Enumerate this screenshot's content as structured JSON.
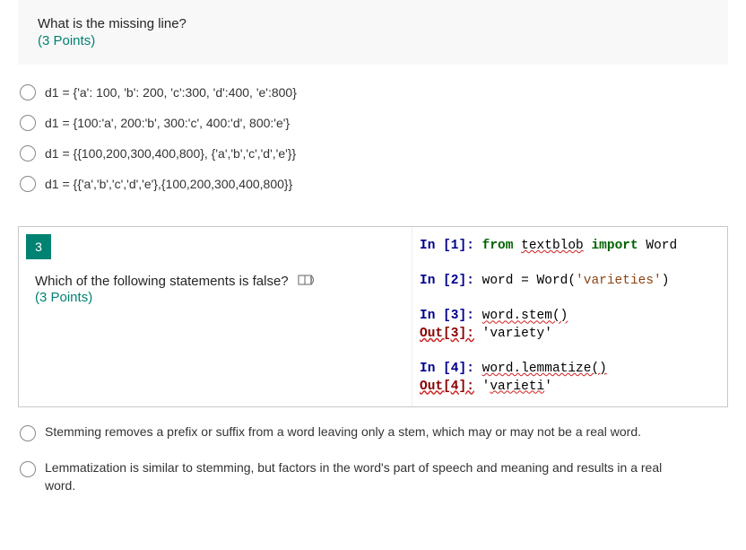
{
  "question1": {
    "text": "What is the missing line?",
    "points": "(3 Points)",
    "options": [
      "d1 = {'a': 100, 'b': 200, 'c':300, 'd':400, 'e':800}",
      "d1 = {100:'a', 200:'b', 300:'c', 400:'d', 800:'e'}",
      "d1 = {{100,200,300,400,800}, {'a','b','c','d','e'}}",
      "d1 = {{'a','b','c','d','e'},{100,200,300,400,800}}"
    ]
  },
  "question2": {
    "number": "3",
    "text": "Which of the following statements is false?",
    "points": "(3 Points)",
    "code": {
      "in1_label": "In [1]:",
      "in1_from": "from",
      "in1_mod": "textblob",
      "in1_import": "import",
      "in1_name": "Word",
      "in2_label": "In [2]:",
      "in2_lhs": "word = Word(",
      "in2_str": "'varieties'",
      "in2_rparen": ")",
      "in3_label": "In [3]:",
      "in3_expr": "word.stem()",
      "out3_label": "Out[3]:",
      "out3_val": "'variety'",
      "in4_label": "In [4]:",
      "in4_expr": "word.lemmatize()",
      "out4_label": "Out[4]:",
      "out4_val": "'varieti'"
    },
    "options": [
      "Stemming removes a prefix or suffix from a word leaving only a stem, which may or may not be a real word.",
      "Lemmatization is similar to stemming, but factors in the word's part of speech and meaning and results in a real word."
    ]
  }
}
